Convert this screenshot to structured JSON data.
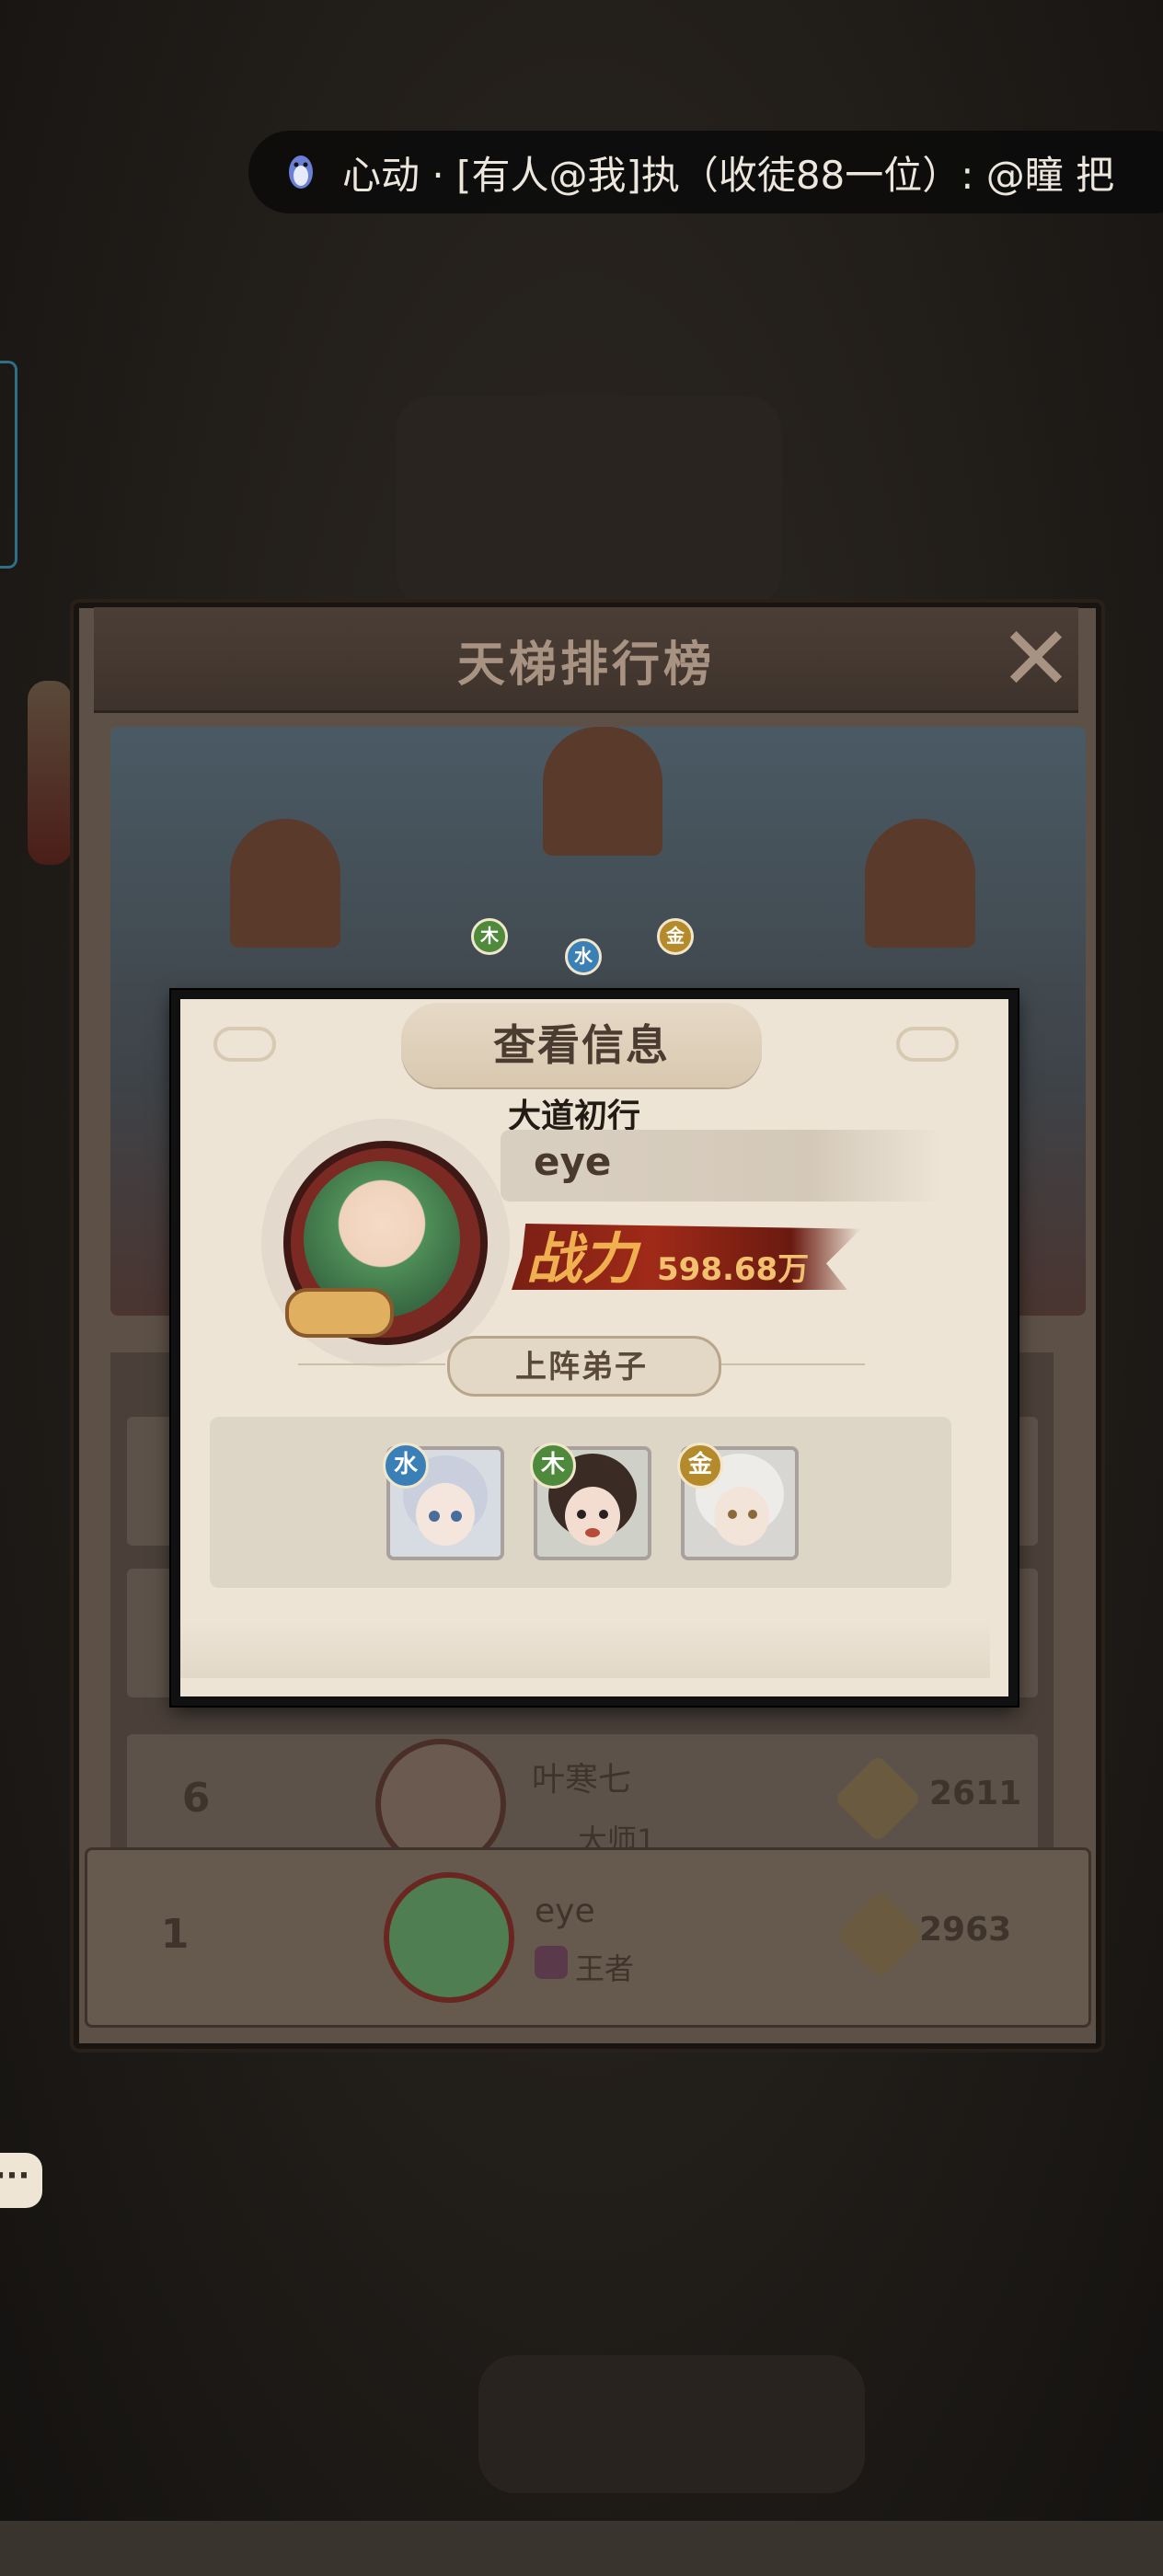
{
  "notification": {
    "text": "心动 · [有人@我]执（收徒88一位）: @瞳 把"
  },
  "ladder_panel": {
    "title": "天梯排行榜",
    "close_glyph": "✕",
    "list": [
      {
        "rank": "6",
        "name": "叶寒七",
        "tier": "大师1",
        "score": "2611"
      }
    ],
    "my_rank": {
      "rank": "1",
      "name": "eye",
      "tier": "王者",
      "score": "2963"
    },
    "banner_elements": [
      "木",
      "水",
      "金"
    ]
  },
  "info_modal": {
    "title": "查看信息",
    "rank_title": "大道初行",
    "player_name": "eye",
    "power_label": "战力",
    "power_value": "598.68万",
    "lineup_label": "上阵弟子",
    "disciples": [
      {
        "element": "水",
        "element_color": "#3a7fb6",
        "hair": "#cfd6e4"
      },
      {
        "element": "木",
        "element_color": "#4f8a3c",
        "hair": "#3a2c24"
      },
      {
        "element": "金",
        "element_color": "#b58a2a",
        "hair": "#e8e6e2"
      }
    ]
  },
  "chat_bubble": "···"
}
